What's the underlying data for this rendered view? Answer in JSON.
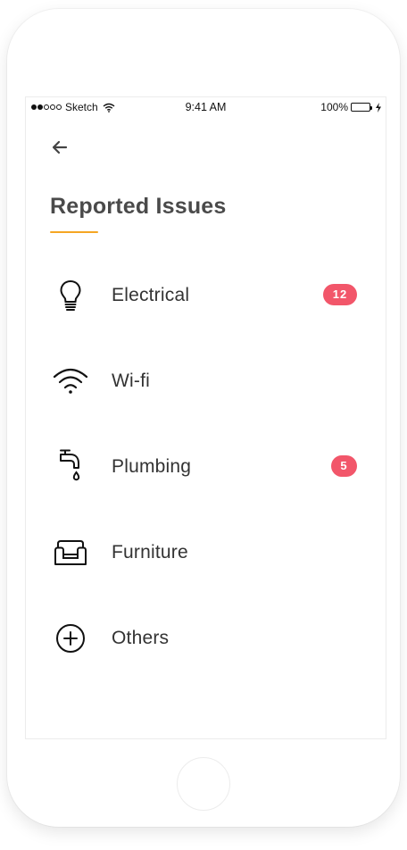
{
  "status_bar": {
    "carrier": "Sketch",
    "time": "9:41 AM",
    "battery": "100%",
    "signal_bars_filled": 2,
    "signal_bars_total": 5
  },
  "header": {
    "back_icon": "arrow-left-icon",
    "title": "Reported Issues",
    "accent_color": "#f5a623"
  },
  "issues": [
    {
      "label": "Electrical",
      "icon": "lightbulb-icon",
      "badge": "12"
    },
    {
      "label": "Wi-fi",
      "icon": "wifi-icon",
      "badge": ""
    },
    {
      "label": "Plumbing",
      "icon": "faucet-icon",
      "badge": "5"
    },
    {
      "label": "Furniture",
      "icon": "sofa-icon",
      "badge": ""
    },
    {
      "label": "Others",
      "icon": "plus-circle-icon",
      "badge": ""
    }
  ],
  "colors": {
    "badge": "#f2566a",
    "battery": "#2ecc40",
    "title": "#4a4a4a"
  }
}
